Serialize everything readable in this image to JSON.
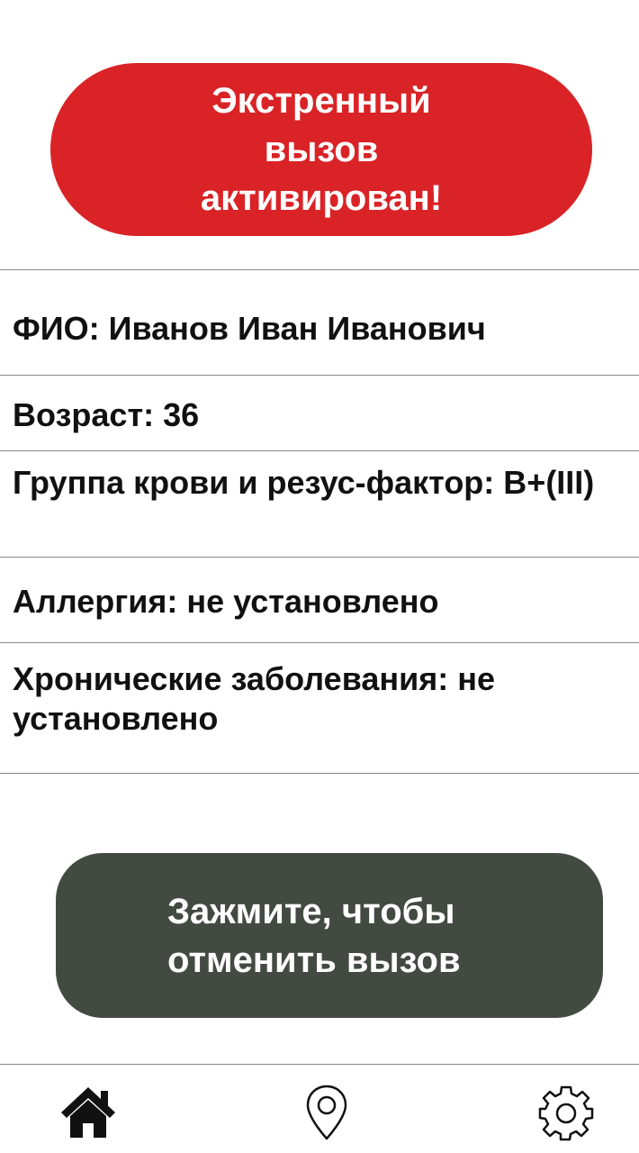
{
  "alert": {
    "title": "Экстренный вызов активирован!",
    "color": "#d92326"
  },
  "profile": {
    "full_name": "ФИО: Иванов Иван Иванович",
    "age": "Возраст: 36",
    "blood_type": "Группа крови и резус-фактор: B+(III)",
    "allergy": "Аллергия: не установлено",
    "chronic": "Хронические заболевания: не установлено"
  },
  "cancel_button": {
    "label": "Зажмите, чтобы отменить вызов",
    "color": "#434a42"
  },
  "nav": {
    "items": [
      {
        "name": "home",
        "icon": "home-icon",
        "active": true
      },
      {
        "name": "location",
        "icon": "location-pin-icon",
        "active": false
      },
      {
        "name": "settings",
        "icon": "gear-icon",
        "active": false
      }
    ]
  }
}
